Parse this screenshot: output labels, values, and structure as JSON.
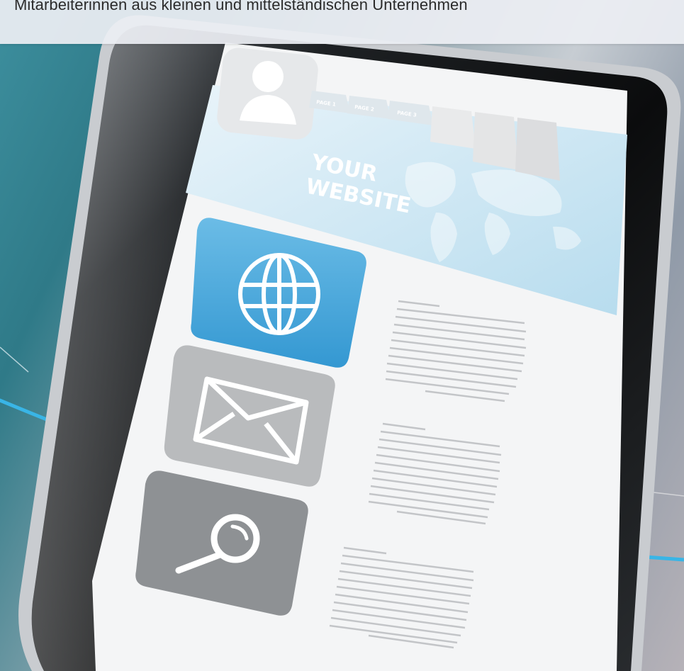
{
  "banner": {
    "text": "Mitarbeiterinnen aus kleinen und mittelständischen Unternehmen"
  },
  "tablet_screen": {
    "tabs": [
      "PAGE 1",
      "PAGE 2",
      "PAGE 3"
    ],
    "headline_line1": "YOUR",
    "headline_line2": "WEBSITE"
  },
  "icons": [
    "avatar-icon",
    "globe-icon",
    "envelope-icon",
    "magnifier-icon"
  ],
  "colors": {
    "banner_bg": "#eceef3",
    "screen_header": "#cfe8f4",
    "globe_tile": "#48a9dc",
    "envelope_tile": "#b9bbbd",
    "search_tile": "#8e9194",
    "light_streak": "#39b5e6"
  }
}
